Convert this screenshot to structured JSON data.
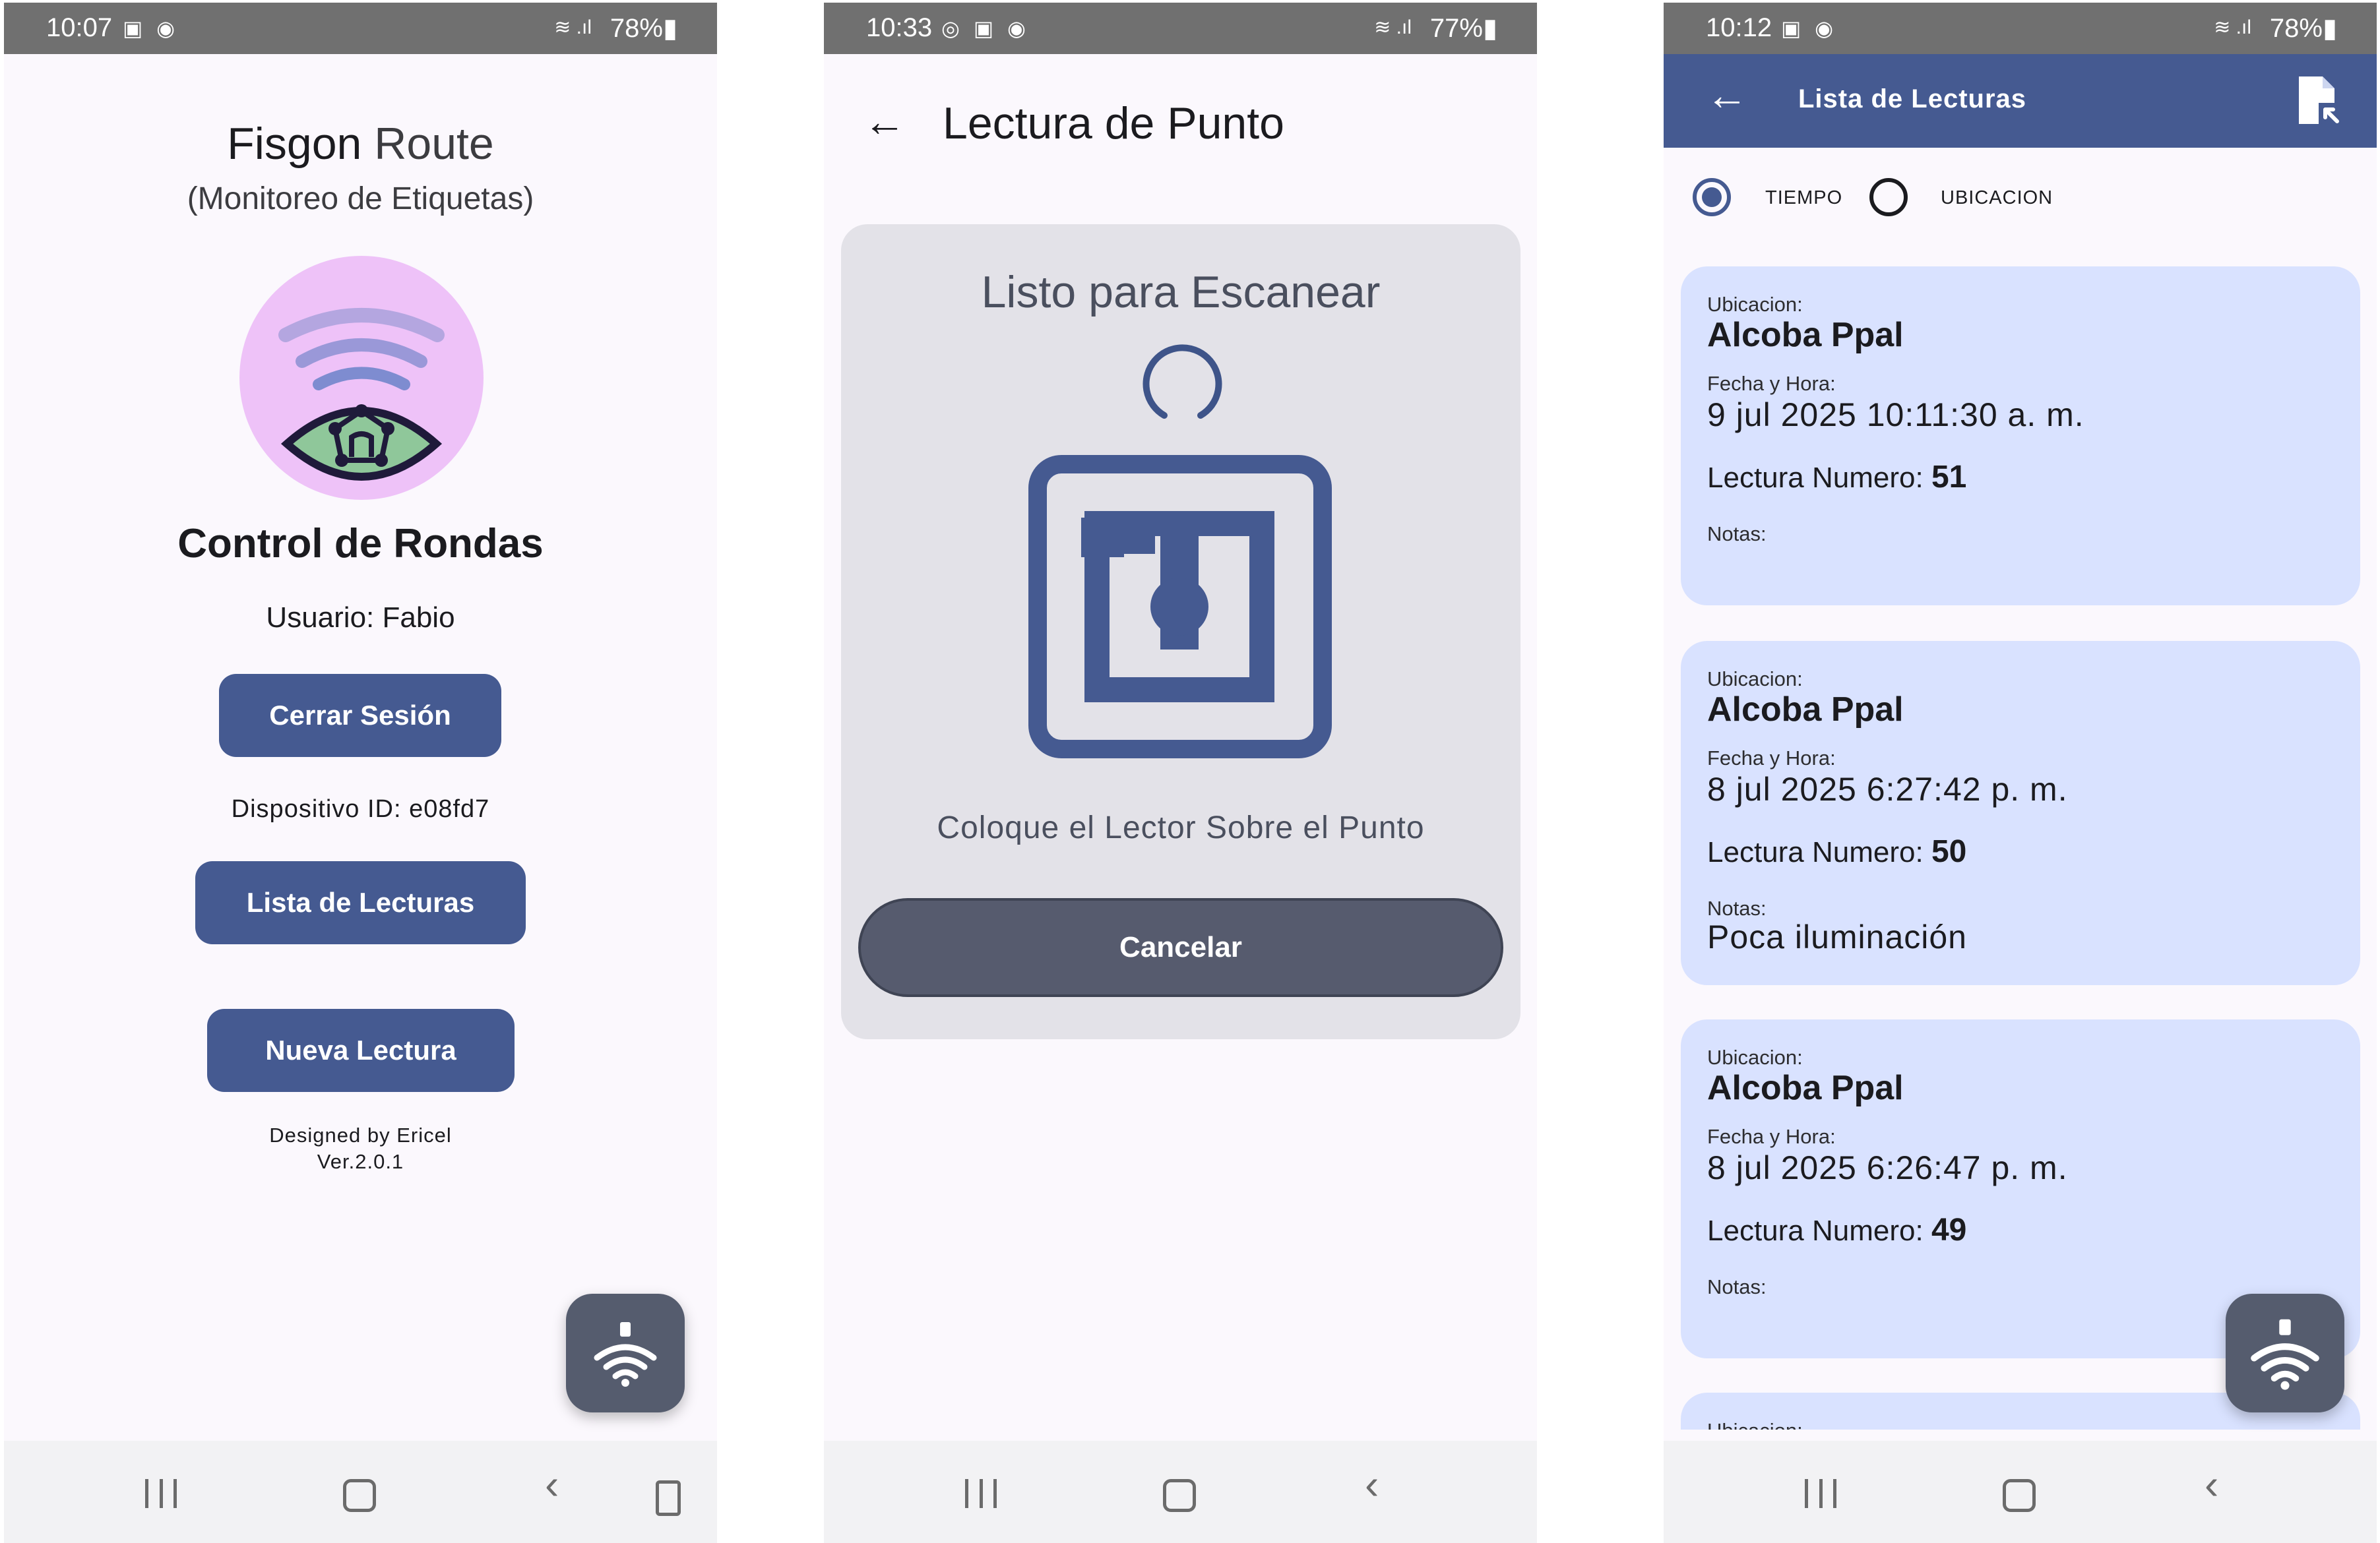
{
  "screen1": {
    "status": {
      "time": "10:07",
      "battery": "78%"
    },
    "app_title_a": "Fisgon",
    "app_title_b": "Route",
    "subtitle": "(Monitoreo de Etiquetas)",
    "heading": "Control de Rondas",
    "user_line": "Usuario: Fabio",
    "logout_label": "Cerrar Sesión",
    "device_line": "Dispositivo ID: e08fd7",
    "list_button": "Lista de Lecturas",
    "new_button": "Nueva Lectura",
    "designer": "Designed by Ericel",
    "version": "Ver.2.0.1"
  },
  "screen2": {
    "status": {
      "time": "10:33",
      "battery": "77%"
    },
    "title": "Lectura de Punto",
    "ready_text": "Listo para Escanear",
    "instruction": "Coloque el Lector Sobre el Punto",
    "cancel_label": "Cancelar"
  },
  "screen3": {
    "status": {
      "time": "10:12",
      "battery": "78%"
    },
    "title": "Lista de Lecturas",
    "radio_time": "TIEMPO",
    "radio_location": "UBICACION",
    "labels": {
      "location": "Ubicacion:",
      "datetime": "Fecha y Hora:",
      "number": "Lectura Numero:",
      "notes": "Notas:"
    },
    "readings": [
      {
        "location": "Alcoba Ppal",
        "datetime": "9 jul 2025 10:11:30 a. m.",
        "number": "51",
        "notes": ""
      },
      {
        "location": "Alcoba Ppal",
        "datetime": "8 jul 2025 6:27:42 p. m.",
        "number": "50",
        "notes": "Poca iluminación"
      },
      {
        "location": "Alcoba Ppal",
        "datetime": "8 jul 2025 6:26:47 p. m.",
        "number": "49",
        "notes": ""
      }
    ],
    "partial_label": "Ubicacion:"
  },
  "colors": {
    "primary": "#455a91",
    "card": "#d9e2ff",
    "fab": "#555c6e",
    "status_bar": "#707070"
  }
}
